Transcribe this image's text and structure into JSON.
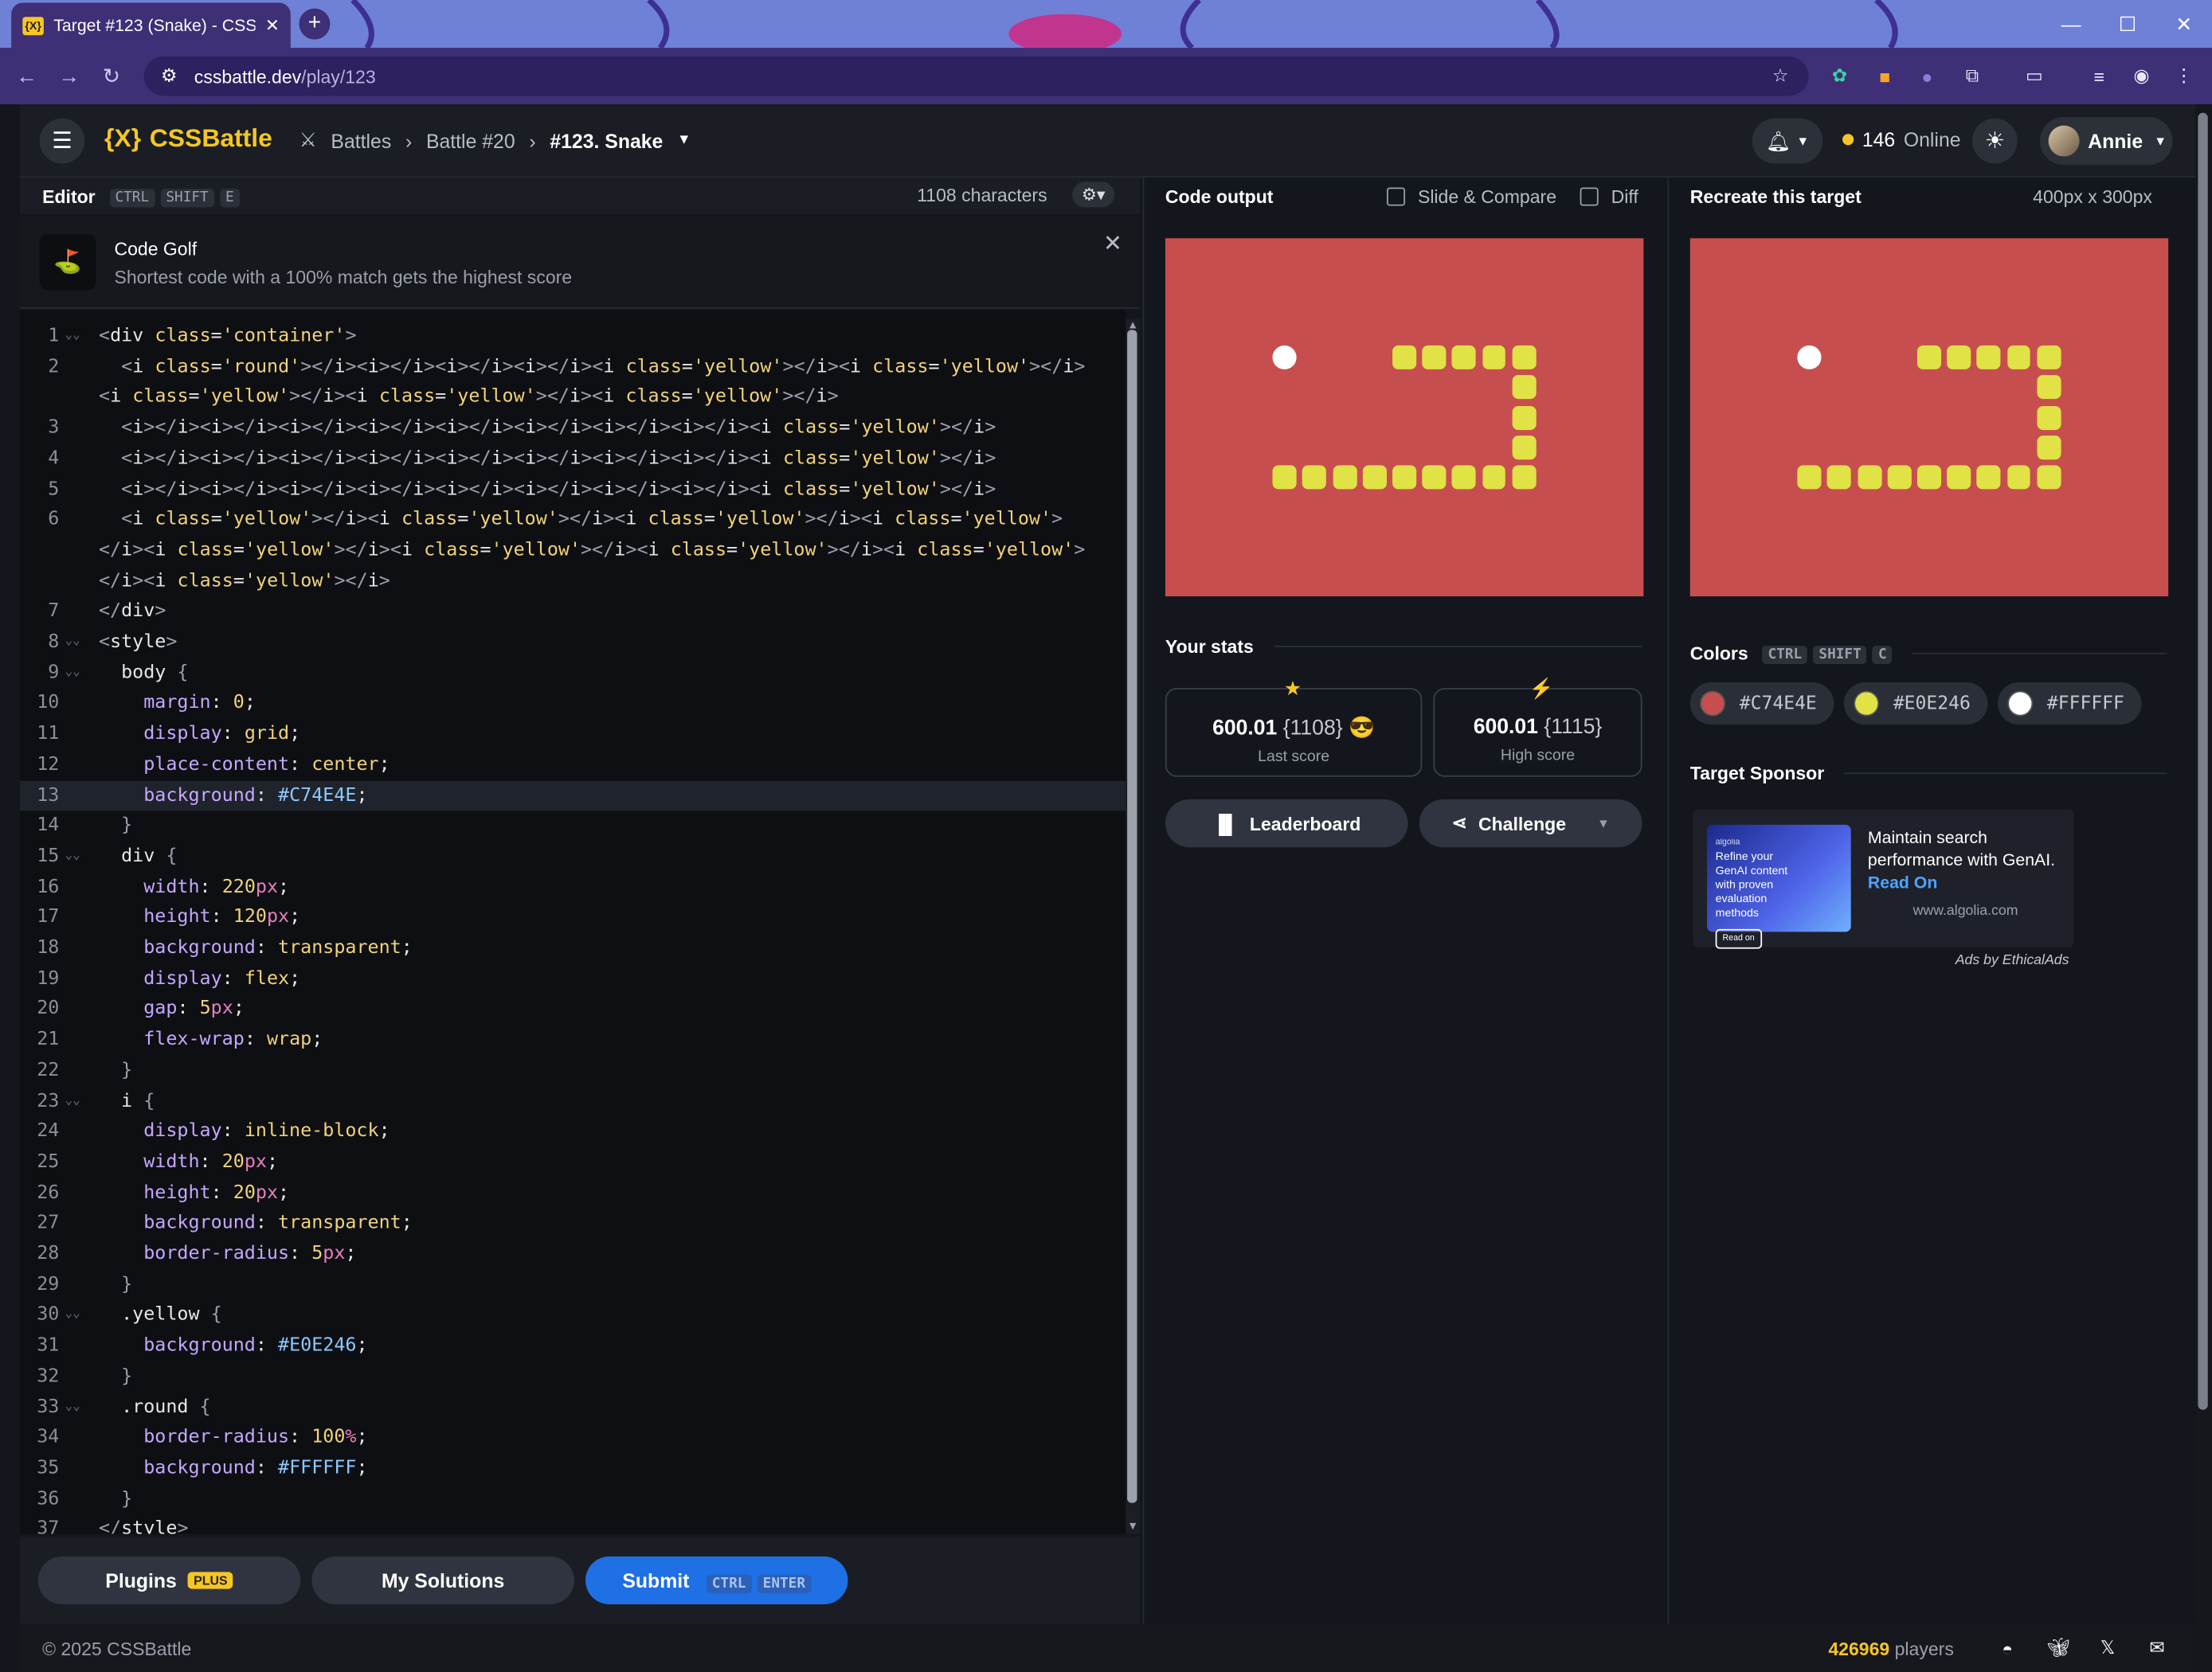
{
  "browser": {
    "tab_title": "Target #123 (Snake) - CSSBattle",
    "url_host": "cssbattle.dev",
    "url_path": "/play/123"
  },
  "header": {
    "logo_text": "CSSBattle",
    "logo_mark": "{X}",
    "breadcrumb": [
      "Battles",
      "Battle #20",
      "#123. Snake"
    ],
    "online_count": "146",
    "online_label": "Online",
    "user_name": "Annie"
  },
  "editor": {
    "title": "Editor",
    "shortcut": [
      "CTRL",
      "SHIFT",
      "E"
    ],
    "char_count": "1108 characters",
    "golf_title": "Code Golf",
    "golf_subtitle": "Shortest code with a 100% match gets the highest score",
    "highlighted_line": 13,
    "lines": [
      {
        "n": "1",
        "fold": true,
        "text": "<div class='container'>"
      },
      {
        "n": "2",
        "fold": false,
        "text": "  <i class='round'></i><i></i><i></i><i></i><i class='yellow'></i><i class='yellow'></i>"
      },
      {
        "n": "",
        "fold": false,
        "text": "<i class='yellow'></i><i class='yellow'></i><i class='yellow'></i>"
      },
      {
        "n": "3",
        "fold": false,
        "text": "  <i></i><i></i><i></i><i></i><i></i><i></i><i></i><i></i><i class='yellow'></i>"
      },
      {
        "n": "4",
        "fold": false,
        "text": "  <i></i><i></i><i></i><i></i><i></i><i></i><i></i><i></i><i class='yellow'></i>"
      },
      {
        "n": "5",
        "fold": false,
        "text": "  <i></i><i></i><i></i><i></i><i></i><i></i><i></i><i></i><i class='yellow'></i>"
      },
      {
        "n": "6",
        "fold": false,
        "text": "  <i class='yellow'></i><i class='yellow'></i><i class='yellow'></i><i class='yellow'>"
      },
      {
        "n": "",
        "fold": false,
        "text": "</i><i class='yellow'></i><i class='yellow'></i><i class='yellow'></i><i class='yellow'>"
      },
      {
        "n": "",
        "fold": false,
        "text": "</i><i class='yellow'></i>"
      },
      {
        "n": "7",
        "fold": false,
        "text": "</div>"
      },
      {
        "n": "8",
        "fold": true,
        "text": "<style>"
      },
      {
        "n": "9",
        "fold": true,
        "text": "  body {"
      },
      {
        "n": "10",
        "fold": false,
        "text": "    margin: 0;"
      },
      {
        "n": "11",
        "fold": false,
        "text": "    display: grid;"
      },
      {
        "n": "12",
        "fold": false,
        "text": "    place-content: center;"
      },
      {
        "n": "13",
        "fold": false,
        "text": "    background: #C74E4E;"
      },
      {
        "n": "14",
        "fold": false,
        "text": "  }"
      },
      {
        "n": "15",
        "fold": true,
        "text": "  div {"
      },
      {
        "n": "16",
        "fold": false,
        "text": "    width: 220px;"
      },
      {
        "n": "17",
        "fold": false,
        "text": "    height: 120px;"
      },
      {
        "n": "18",
        "fold": false,
        "text": "    background: transparent;"
      },
      {
        "n": "19",
        "fold": false,
        "text": "    display: flex;"
      },
      {
        "n": "20",
        "fold": false,
        "text": "    gap: 5px;"
      },
      {
        "n": "21",
        "fold": false,
        "text": "    flex-wrap: wrap;"
      },
      {
        "n": "22",
        "fold": false,
        "text": "  }"
      },
      {
        "n": "23",
        "fold": true,
        "text": "  i {"
      },
      {
        "n": "24",
        "fold": false,
        "text": "    display: inline-block;"
      },
      {
        "n": "25",
        "fold": false,
        "text": "    width: 20px;"
      },
      {
        "n": "26",
        "fold": false,
        "text": "    height: 20px;"
      },
      {
        "n": "27",
        "fold": false,
        "text": "    background: transparent;"
      },
      {
        "n": "28",
        "fold": false,
        "text": "    border-radius: 5px;"
      },
      {
        "n": "29",
        "fold": false,
        "text": "  }"
      },
      {
        "n": "30",
        "fold": true,
        "text": "  .yellow {"
      },
      {
        "n": "31",
        "fold": false,
        "text": "    background: #E0E246;"
      },
      {
        "n": "32",
        "fold": false,
        "text": "  }"
      },
      {
        "n": "33",
        "fold": true,
        "text": "  .round {"
      },
      {
        "n": "34",
        "fold": false,
        "text": "    border-radius: 100%;"
      },
      {
        "n": "35",
        "fold": false,
        "text": "    background: #FFFFFF;"
      },
      {
        "n": "36",
        "fold": false,
        "text": "  }"
      },
      {
        "n": "37",
        "fold": false,
        "text": "</style>"
      }
    ],
    "buttons": {
      "plugins": "Plugins",
      "plus": "PLUS",
      "solutions": "My Solutions",
      "submit": "Submit",
      "submit_keys": [
        "CTRL",
        "ENTER"
      ]
    }
  },
  "output": {
    "title": "Code output",
    "slide_compare": "Slide & Compare",
    "diff": "Diff",
    "stats_title": "Your stats",
    "last_score": "600.01",
    "last_chars": "{1108}",
    "last_label": "Last score",
    "high_score": "600.01",
    "high_chars": "{1115}",
    "high_label": "High score",
    "leaderboard": "Leaderboard",
    "challenge": "Challenge"
  },
  "target": {
    "title": "Recreate this target",
    "size": "400px x 300px",
    "colors_title": "Colors",
    "colors_shortcut": [
      "CTRL",
      "SHIFT",
      "C"
    ],
    "colors": [
      "#C74E4E",
      "#E0E246",
      "#FFFFFF"
    ],
    "sponsor_title": "Target Sponsor",
    "ad_text": "Maintain search performance with GenAI.",
    "ad_link": "Read On",
    "ad_url": "www.algolia.com",
    "ad_image_text": "Refine your GenAI content with proven evaluation methods",
    "ad_image_button": "Read on",
    "ad_image_brand": "algolia",
    "ads_by": "Ads by EthicalAds"
  },
  "footer": {
    "copyright": "© 2025 CSSBattle",
    "players_count": "426969",
    "players_label": "players"
  },
  "palette": {
    "red": "#C74E4E",
    "yellow": "#E0E246",
    "white": "#FFFFFF",
    "accent": "#f6c624",
    "submit": "#1f6fe5"
  }
}
